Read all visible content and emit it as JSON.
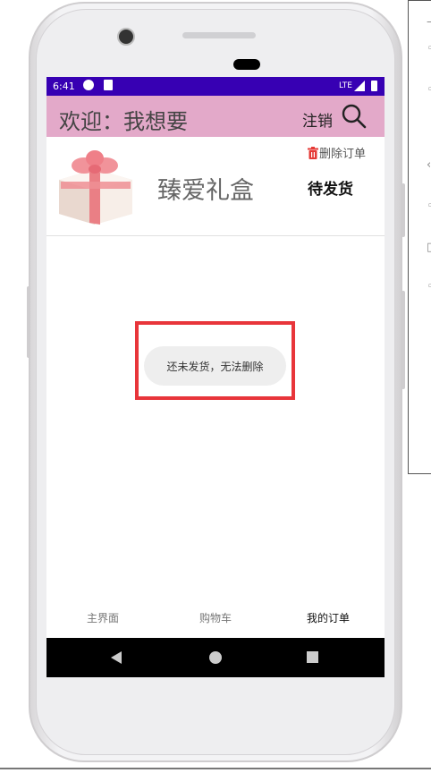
{
  "status_bar": {
    "time": "6:41",
    "network": "LTE"
  },
  "header": {
    "welcome_text": "欢迎：我想要",
    "logout_label": "注销",
    "search_icon": "search-icon"
  },
  "order": {
    "product_name": "臻爱礼盒",
    "delete_label": "删除订单",
    "status": "待发货"
  },
  "toast": {
    "message": "还未发货，无法删除"
  },
  "bottom_nav": {
    "items": [
      {
        "label": "主界面",
        "active": false
      },
      {
        "label": "购物车",
        "active": false
      },
      {
        "label": "我的订单",
        "active": true
      }
    ]
  },
  "colors": {
    "status_bar": "#3700b3",
    "header": "#e3a9c9",
    "highlight": "#e8353a",
    "trash": "#e53935"
  }
}
